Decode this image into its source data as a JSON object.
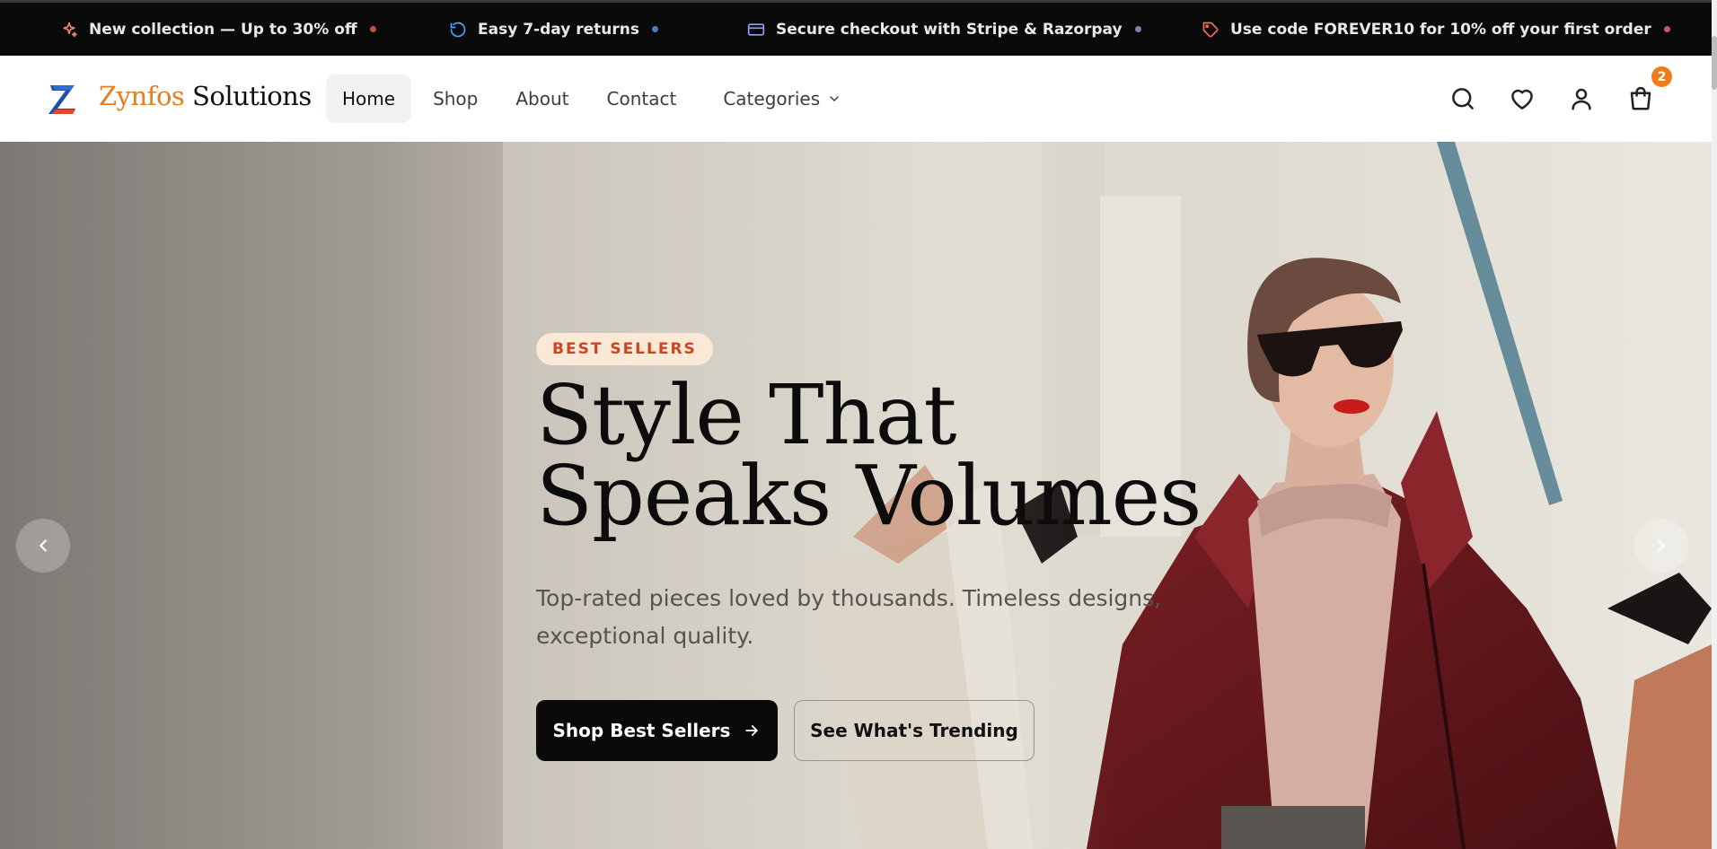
{
  "announcements": [
    {
      "text": "New collection — Up to 30% off",
      "icon": "sparkle-icon",
      "icon_color": "#e08a6d",
      "dot_color": "#c0553d"
    },
    {
      "text": "Easy 7-day returns",
      "icon": "refresh-icon",
      "icon_color": "#4da3ff",
      "dot_color": "#4d79c9"
    },
    {
      "text": "Secure checkout with Stripe & Razorpay",
      "icon": "credit-card-icon",
      "icon_color": "#8ea0ff",
      "dot_color": "#7884a8"
    },
    {
      "text": "Use code FOREVER10 for 10% off your first order",
      "icon": "tag-icon",
      "icon_color": "#ff6b5a",
      "dot_color": "#c25b6c"
    }
  ],
  "brand": {
    "name_part1": "Zynfos",
    "name_part2": "Solutions",
    "accent": "#ea7a1f"
  },
  "nav": {
    "items": [
      "Home",
      "Shop",
      "About",
      "Contact",
      "Categories"
    ],
    "active": "Home"
  },
  "header_icons": [
    "search-icon",
    "heart-icon",
    "user-icon",
    "shopping-bag-icon"
  ],
  "cart": {
    "count": "2",
    "badge_color": "#f07b1c"
  },
  "hero": {
    "badge": "BEST SELLERS",
    "title_line1": "Style That",
    "title_line2": "Speaks Volumes",
    "subtitle": "Top-rated pieces loved by thousands. Timeless designs, exceptional quality.",
    "primary_cta": "Shop Best Sellers",
    "secondary_cta": "See What's Trending"
  }
}
